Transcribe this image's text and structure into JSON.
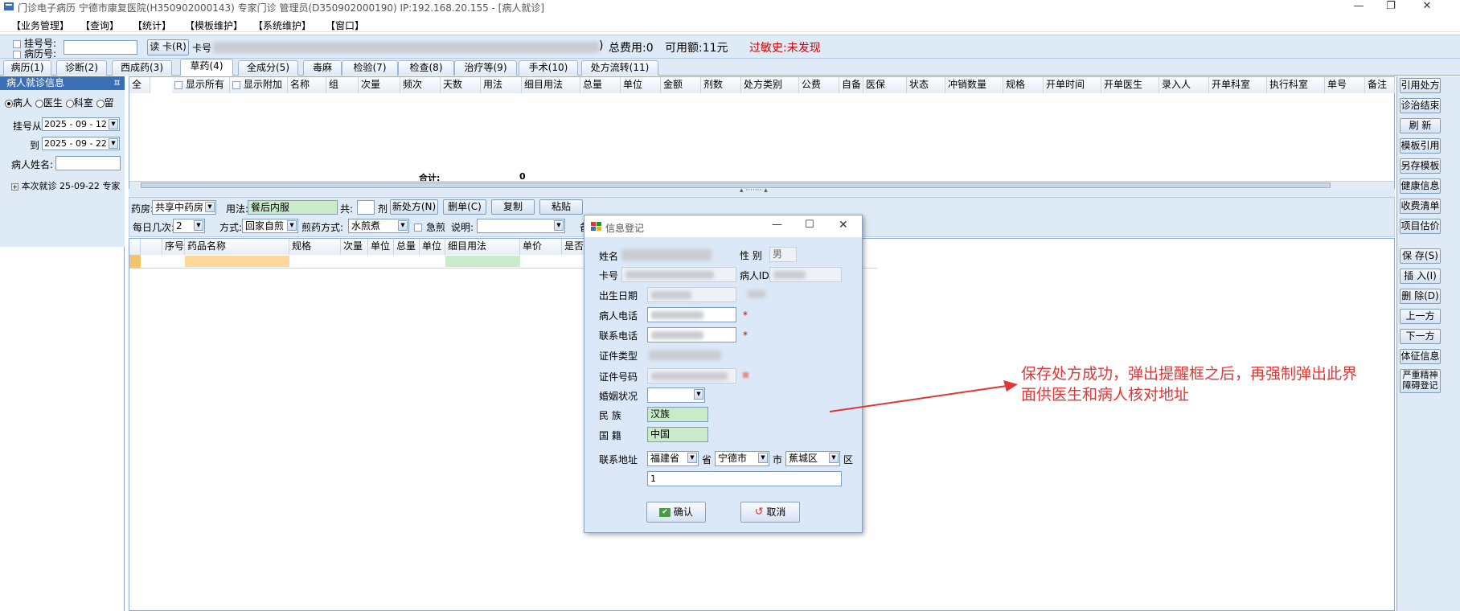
{
  "window": {
    "title": "门诊电子病历   宁德市康复医院(H350902000143)  专家门诊  管理员(D350902000190) IP:192.168.20.155 - [病人就诊]"
  },
  "menu": [
    "【业务管理】",
    "【查询】",
    "【统计】",
    "【模板维护】",
    "【系统维护】",
    "【窗口】"
  ],
  "patient_bar": {
    "reg_no_label": "挂号号:",
    "record_no_label": "病历号:",
    "read_card": "读 卡(R)",
    "card_label": "卡号",
    "total_fee": "总费用:0",
    "available": "可用额:11元",
    "allergy": "过敏史:未发现"
  },
  "tabs": [
    "病历(1)",
    "诊断(2)",
    "西成药(3)",
    "草药(4)",
    "全成分(5)",
    "毒麻",
    "检验(7)",
    "检查(8)",
    "治疗等(9)",
    "手术(10)",
    "处方流转(11)"
  ],
  "left_panel": {
    "header": "病人就诊信息",
    "pin": "ㅍ",
    "radios": [
      "病人",
      "医生",
      "科室",
      "留"
    ],
    "from_label": "挂号从",
    "from_date": "2025 - 09 - 12",
    "to_label": "到",
    "to_date": "2025 - 09 - 22",
    "name_label": "病人姓名:",
    "tree_item": "本次就诊 25-09-22 专家"
  },
  "upper_grid": {
    "headers": [
      "全",
      "显示所有",
      "显示附加",
      "名称",
      "组",
      "次量",
      "频次",
      "天数",
      "用法",
      "细目用法",
      "总量",
      "单位",
      "金额",
      "剂数",
      "处方类别",
      "公费",
      "自备",
      "医保",
      "状态",
      "冲销数量",
      "规格",
      "开单时间",
      "开单医生",
      "录入人",
      "开单科室",
      "执行科室",
      "单号",
      "备注"
    ],
    "total_label": "合计:",
    "total_value": "0"
  },
  "right_buttons": [
    "引用处方",
    "诊治结束",
    "刷 新",
    "模板引用",
    "另存模板",
    "健康信息",
    "收费清单",
    "项目估价",
    "保 存(S)",
    "插 入(I)",
    "删 除(D)",
    "上一方",
    "下一方",
    "体征信息",
    "严重精神障碍登记"
  ],
  "mid_bar": {
    "pharmacy_label": "药房:",
    "pharmacy_value": "共享中药房",
    "usage_label": "用法:",
    "usage_value": "餐后内服",
    "total_label": "共:",
    "dose_unit": "剂",
    "new_btn": "新处方(N)",
    "del_btn": "删单(C)",
    "copy_btn": "复制",
    "paste_btn": "粘贴",
    "daily_label": "每日几次:",
    "daily_value": "2",
    "method_label": "方式:",
    "method_value": "回家自煎",
    "decoct_label": "煎药方式:",
    "decoct_value": "水煎煮",
    "urgent_label": "急煎",
    "note_label": "说明:",
    "extra": "备"
  },
  "lower_grid": {
    "headers": [
      "序号",
      "药品名称",
      "规格",
      "次量",
      "单位",
      "总量",
      "单位",
      "细目用法",
      "单价",
      "是否"
    ]
  },
  "dialog": {
    "title": "信息登记",
    "name_label": "姓名",
    "gender_label": "性 别",
    "gender_value": "男",
    "card_label": "卡号",
    "pid_label": "病人ID",
    "dob_label": "出生日期",
    "phone_label": "病人电话",
    "contact_label": "联系电话",
    "idtype_label": "证件类型",
    "idno_label": "证件号码",
    "marital_label": "婚姻状况",
    "nation_label": "民    族",
    "nation_value": "汉族",
    "country_label": "国    籍",
    "country_value": "中国",
    "addr_label": "联系地址",
    "province": "福建省",
    "province_unit": "省",
    "city": "宁德市",
    "city_unit": "市",
    "district": "蕉城区",
    "district_unit": "区",
    "addr_detail": "1",
    "required_mark": "*",
    "confirm": "确认",
    "cancel": "取消"
  },
  "annotation": "保存处方成功，弹出提醒框之后，再强制弹出此界面供医生和病人核对地址",
  "colors": {
    "accent": "#3a6fb5",
    "panel": "#dfeaf7",
    "annotation": "#e23535",
    "allergy": "#d00000"
  }
}
